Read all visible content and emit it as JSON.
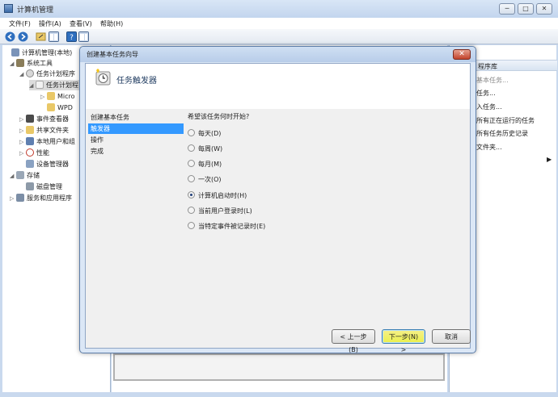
{
  "main_window": {
    "title": "计算机管理",
    "menu": [
      "文件(F)",
      "操作(A)",
      "查看(V)",
      "帮助(H)"
    ],
    "caption_buttons": {
      "minimize": "─",
      "maximize": "□",
      "close": "✕"
    }
  },
  "tree": [
    {
      "label": "计算机管理(本地)",
      "exp": ""
    },
    {
      "label": "系统工具",
      "exp": "◢"
    },
    {
      "label": "任务计划程序",
      "exp": "◢"
    },
    {
      "label": "任务计划程",
      "exp": "◢"
    },
    {
      "label": "Micro",
      "exp": "▷"
    },
    {
      "label": "WPD",
      "exp": ""
    },
    {
      "label": "事件查看器",
      "exp": "▷"
    },
    {
      "label": "共享文件夹",
      "exp": "▷"
    },
    {
      "label": "本地用户和组",
      "exp": "▷"
    },
    {
      "label": "性能",
      "exp": "▷"
    },
    {
      "label": "设备管理器",
      "exp": ""
    },
    {
      "label": "存储",
      "exp": "◢"
    },
    {
      "label": "磁盘管理",
      "exp": ""
    },
    {
      "label": "服务和应用程序",
      "exp": "▷"
    }
  ],
  "actions": {
    "header": "程序库",
    "items": [
      "基本任务...",
      "任务...",
      "入任务...",
      "所有正在运行的任务",
      "所有任务历史记录",
      "文件夹...",
      "",
      "",
      ""
    ]
  },
  "wizard": {
    "title": "创建基本任务向导",
    "close_glyph": "✕",
    "header_title": "任务触发器",
    "steps": [
      "创建基本任务",
      "触发器",
      "操作",
      "完成"
    ],
    "active_step": 1,
    "question": "希望该任务何时开始?",
    "options": [
      {
        "label": "每天(D)",
        "selected": false
      },
      {
        "label": "每周(W)",
        "selected": false
      },
      {
        "label": "每月(M)",
        "selected": false
      },
      {
        "label": "一次(O)",
        "selected": false
      },
      {
        "label": "计算机启动时(H)",
        "selected": true
      },
      {
        "label": "当前用户登录时(L)",
        "selected": false
      },
      {
        "label": "当特定事件被记录时(E)",
        "selected": false
      }
    ],
    "buttons": {
      "back": "< 上一步(B)",
      "next": "下一步(N) >",
      "cancel": "取消"
    }
  }
}
